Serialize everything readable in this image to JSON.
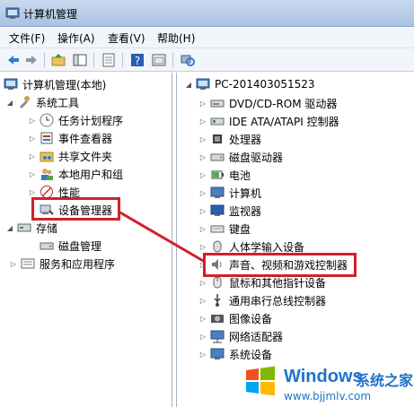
{
  "window": {
    "title": "计算机管理"
  },
  "menu": [
    "文件(F)",
    "操作(A)",
    "查看(V)",
    "帮助(H)"
  ],
  "toolbar": {
    "buttons": [
      "back-icon",
      "forward-icon",
      "up-folder-icon",
      "show-hide-tree-icon",
      "export-list-icon",
      "help-icon",
      "properties-icon",
      "scan-hardware-icon"
    ]
  },
  "left_tree": {
    "root": "计算机管理(本地)",
    "items": [
      "系统工具",
      "任务计划程序",
      "事件查看器",
      "共享文件夹",
      "本地用户和组",
      "性能",
      "设备管理器",
      "存储",
      "磁盘管理",
      "服务和应用程序"
    ]
  },
  "right_tree": {
    "root": "PC-201403051523",
    "items": [
      "DVD/CD-ROM 驱动器",
      "IDE ATA/ATAPI 控制器",
      "处理器",
      "磁盘驱动器",
      "电池",
      "计算机",
      "监视器",
      "键盘",
      "人体学输入设备",
      "声音、视频和游戏控制器",
      "鼠标和其他指针设备",
      "通用串行总线控制器",
      "图像设备",
      "网络适配器",
      "系统设备"
    ]
  },
  "watermark": {
    "brand": "Windows",
    "cn": "系统之家",
    "url": "www.bjjmlv.com"
  },
  "colors": {
    "highlight": "#d21f2b",
    "titlebar": "#c9d9ee",
    "brand": "#1e73c8"
  }
}
